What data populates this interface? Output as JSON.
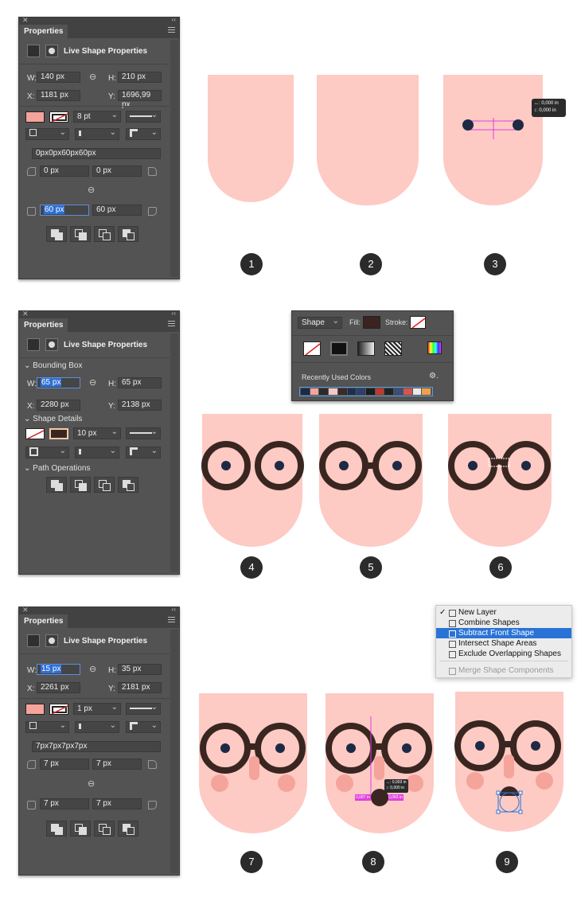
{
  "panels": [
    {
      "title": "Properties",
      "subtitle": "Live Shape Properties",
      "w_label": "W:",
      "w": "140 px",
      "h_label": "H:",
      "h": "210 px",
      "x_label": "X:",
      "x": "1181 px",
      "y_label": "Y:",
      "y": "1696,99 px",
      "stroke_width": "8 pt",
      "radii": "0px0px60px60px",
      "r_tl": "0 px",
      "r_tr": "0 px",
      "r_bl": "60 px",
      "r_br": "60 px",
      "fill_color": "#f5a49b"
    },
    {
      "title": "Properties",
      "subtitle": "Live Shape Properties",
      "bbox": "Bounding Box",
      "w_label": "W:",
      "w": "65 px",
      "h_label": "H:",
      "h": "65 px",
      "x_label": "X:",
      "x": "2280 px",
      "y_label": "Y:",
      "y": "2138 px",
      "shape_details": "Shape Details",
      "stroke_width": "10 px",
      "path_ops": "Path Operations"
    },
    {
      "title": "Properties",
      "subtitle": "Live Shape Properties",
      "w_label": "W:",
      "w": "15 px",
      "h_label": "H:",
      "h": "35 px",
      "x_label": "X:",
      "x": "2261 px",
      "y_label": "Y:",
      "y": "2181 px",
      "stroke_width": "1 px",
      "radii": "7px7px7px7px",
      "r_tl": "7 px",
      "r_tr": "7 px",
      "r_bl": "7 px",
      "r_br": "7 px",
      "fill_color": "#f5a49b"
    }
  ],
  "steps": [
    "1",
    "2",
    "3",
    "4",
    "5",
    "6",
    "7",
    "8",
    "9"
  ],
  "measure_tooltip": {
    "line1": "↔: 0,000 in",
    "line2": "↕: 0,000 in"
  },
  "nose_tooltip": {
    "line1": "↔: 0,003 in",
    "line2": "↕: 0,000 in",
    "left": "0,087 in",
    "right": "0,083 in"
  },
  "fill_popup": {
    "shape_label": "Shape",
    "fill_label": "Fill:",
    "stroke_label": "Stroke:",
    "recent_label": "Recently Used Colors",
    "fill_color": "#3a2320",
    "recent_colors": [
      "#1c2a4a",
      "#f5a49b",
      "#2b2b2b",
      "#f5c9c2",
      "#3a2a28",
      "#1b2f4f",
      "#2a3f6a",
      "#1c1c1c",
      "#c0392b",
      "#222",
      "#3b4d7a",
      "#d9534f",
      "#e9e9e9",
      "#f0a04b"
    ]
  },
  "path_menu": {
    "items": [
      {
        "label": "New Layer",
        "checked": true
      },
      {
        "label": "Combine Shapes"
      },
      {
        "label": "Subtract Front Shape",
        "selected": true
      },
      {
        "label": "Intersect Shape Areas"
      },
      {
        "label": "Exclude Overlapping Shapes"
      },
      {
        "label": "Merge Shape Components",
        "disabled": true
      }
    ]
  },
  "colors": {
    "skin": "#fecac4",
    "frame": "#3a2621",
    "pupil": "#1e2a45",
    "cheek": "#f5a49b",
    "nose": "#f5a49b",
    "selection": "#2a73d6",
    "guide": "#e040e0"
  }
}
